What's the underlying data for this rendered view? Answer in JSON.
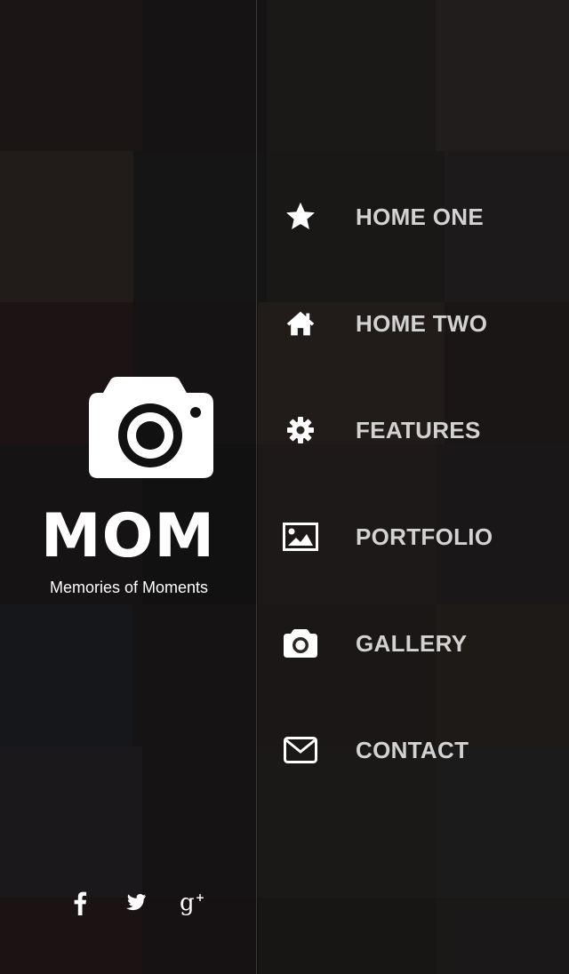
{
  "brand": {
    "title": "MOM",
    "tagline": "Memories of Moments",
    "logo_icon": "camera-icon"
  },
  "social": [
    {
      "name": "facebook",
      "glyph": "f",
      "icon": "facebook-icon"
    },
    {
      "name": "twitter",
      "glyph": "",
      "icon": "twitter-icon"
    },
    {
      "name": "google-plus",
      "glyph": "g+",
      "icon": "google-plus-icon"
    }
  ],
  "menu": {
    "items": [
      {
        "label": "HOME ONE",
        "icon": "star-icon"
      },
      {
        "label": "HOME TWO",
        "icon": "home-icon"
      },
      {
        "label": "FEATURES",
        "icon": "gear-icon"
      },
      {
        "label": "PORTFOLIO",
        "icon": "image-icon"
      },
      {
        "label": "GALLERY",
        "icon": "camera-icon"
      },
      {
        "label": "CONTACT",
        "icon": "envelope-icon"
      }
    ]
  },
  "colors": {
    "text_primary": "#ffffff",
    "menu_text": "#d2d2d2",
    "overlay": "#08080c"
  }
}
